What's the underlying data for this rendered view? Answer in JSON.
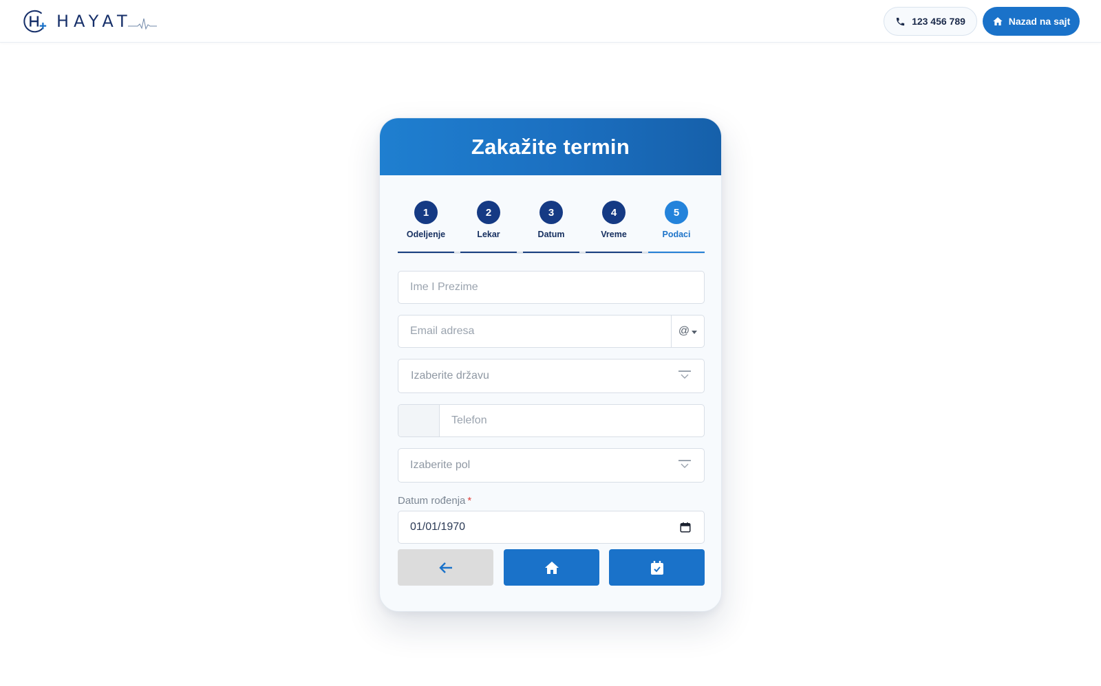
{
  "header": {
    "logo_text": "HAYAT",
    "phone_label": "123 456 789",
    "back_to_site_label": "Nazad na sajt",
    "icons": {
      "phone": "phone-icon",
      "home": "home-icon"
    },
    "accent_color": "#1a72c9"
  },
  "card": {
    "title": "Zakažite termin",
    "steps": [
      {
        "number": "1",
        "label": "Odeljenje",
        "active": false
      },
      {
        "number": "2",
        "label": "Lekar",
        "active": false
      },
      {
        "number": "3",
        "label": "Datum",
        "active": false
      },
      {
        "number": "4",
        "label": "Vreme",
        "active": false
      },
      {
        "number": "5",
        "label": "Podaci",
        "active": true
      }
    ],
    "form": {
      "name": {
        "placeholder": "Ime I Prezime",
        "value": ""
      },
      "email": {
        "placeholder": "Email adresa",
        "value": "",
        "addon": "@"
      },
      "country": {
        "placeholder": "Izaberite državu"
      },
      "phone": {
        "placeholder": "Telefon",
        "value": ""
      },
      "gender": {
        "placeholder": "Izaberite pol"
      },
      "dob": {
        "label": "Datum rođenja",
        "required_mark": "*",
        "value": "01/01/1970"
      }
    },
    "buttons": {
      "back_icon": "arrow-left-icon",
      "home_icon": "home-icon",
      "book_icon": "calendar-check-icon"
    }
  }
}
